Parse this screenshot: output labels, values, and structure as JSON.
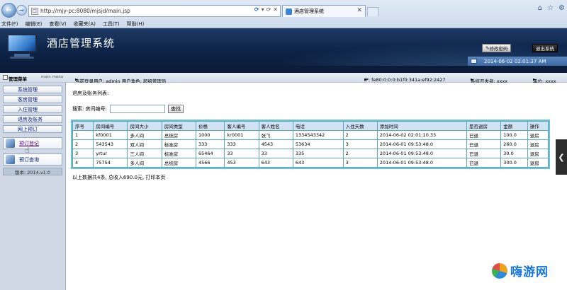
{
  "browser": {
    "url": "http://mjy-pc:8080/mjsjd/main.jsp",
    "addr_tools": [
      "▾",
      "⟳",
      "✕"
    ],
    "tab_title": "酒店管理系统",
    "tab_close": "✕",
    "window_buttons": [
      "⌂",
      "☆",
      "⚙"
    ],
    "menu": [
      "文件(F)",
      "编辑(E)",
      "查看(V)",
      "收藏夹(A)",
      "工具(T)",
      "帮助(H)"
    ]
  },
  "header": {
    "title": "酒店管理系统",
    "change_password": "修改密码",
    "logout": "退出系统",
    "datetime": "2014-06-02 02:01:37 AM"
  },
  "info": {
    "sidebar_title": "管理菜单",
    "sidebar_sub": "main menu",
    "user": "当前登录用户: admin  用户角色: 超级管理员",
    "ip": "IP: fe80:0:0:0:b1f0:341a:ef92:2427",
    "developer": "系统开发者: xxxx",
    "unit": "单位: xxxx"
  },
  "sidebar": {
    "items": [
      {
        "label": "系统管理"
      },
      {
        "label": "客房管理"
      },
      {
        "label": "入住管理"
      },
      {
        "label": "退房及账务"
      },
      {
        "label": "网上预订"
      }
    ],
    "big_items": [
      {
        "label": "预订登记"
      },
      {
        "label": "预订查询"
      }
    ],
    "version": "版本: 2014.v1.0"
  },
  "main": {
    "section_title": "退房及账务列表:",
    "search_label": "搜索: 房间编号:",
    "search_value": "",
    "search_button": "查找",
    "columns": [
      "序号",
      "房间编号",
      "房间大小",
      "房间类型",
      "价格",
      "客人编号",
      "客人姓名",
      "电话",
      "入住天数",
      "添加时间",
      "是否退房",
      "金额",
      "操作"
    ],
    "rows": [
      [
        "1",
        "kf0001",
        "多人间",
        "总统房",
        "1000",
        "kr0001",
        "张飞",
        "1334543342",
        "2",
        "2014-06-02 02:01:10.33",
        "已退",
        "100.0",
        "退房"
      ],
      [
        "2",
        "543543",
        "双人间",
        "标准房",
        "333",
        "333",
        "4543",
        "53634",
        "3",
        "2014-06-01 09:53:48.0",
        "已退",
        "260.0",
        "退房"
      ],
      [
        "3",
        "yrtur",
        "三人间",
        "标准房",
        "65464",
        "33",
        "33",
        "335",
        "2",
        "2014-06-01 09:53:48.0",
        "已退",
        "30.0",
        "退房"
      ],
      [
        "4",
        "75754",
        "多人间",
        "总统房",
        "4566",
        "453",
        "643",
        "643",
        "3",
        "2014-06-01 09:53:48.0",
        "已退",
        "300.0",
        "退房"
      ]
    ],
    "footer": "以上数据共4条, 总收入690.0元, 打印本页"
  },
  "watermark": {
    "text": "嗨游网"
  }
}
